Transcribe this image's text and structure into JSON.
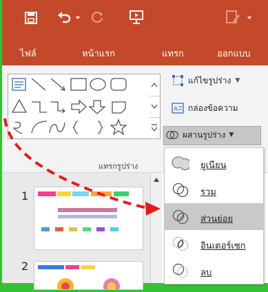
{
  "colors": {
    "accent": "#c4492a",
    "highlight_border": "#35c232",
    "arrow": "#e8191a"
  },
  "titlebar": {
    "icons": [
      "save-icon",
      "undo-icon",
      "redo-icon",
      "present-from-beginning-icon",
      "customize-icon"
    ]
  },
  "tabs": [
    {
      "label": "ไฟล์"
    },
    {
      "label": "หน้าแรก"
    },
    {
      "label": "แทรก"
    },
    {
      "label": "ออกแบบ"
    }
  ],
  "ribbon": {
    "edit_shape_label": "แก้ไขรูปร่าง",
    "text_box_label": "กล่องข้อความ",
    "merge_shapes_label": "ผสานรูปร่าง",
    "group_label": "แทรกรูปร่าง"
  },
  "merge_menu": {
    "items": [
      {
        "label": "ยูเนียน",
        "icon": "union-icon"
      },
      {
        "label": "รวม",
        "icon": "combine-icon"
      },
      {
        "label": "ส่วนย่อย",
        "icon": "fragment-icon",
        "selected": true
      },
      {
        "label": "อินเตอร์เซก",
        "icon": "intersect-icon"
      },
      {
        "label": "ลบ",
        "icon": "subtract-icon"
      }
    ]
  },
  "slides": [
    {
      "number": "1"
    },
    {
      "number": "2"
    }
  ]
}
